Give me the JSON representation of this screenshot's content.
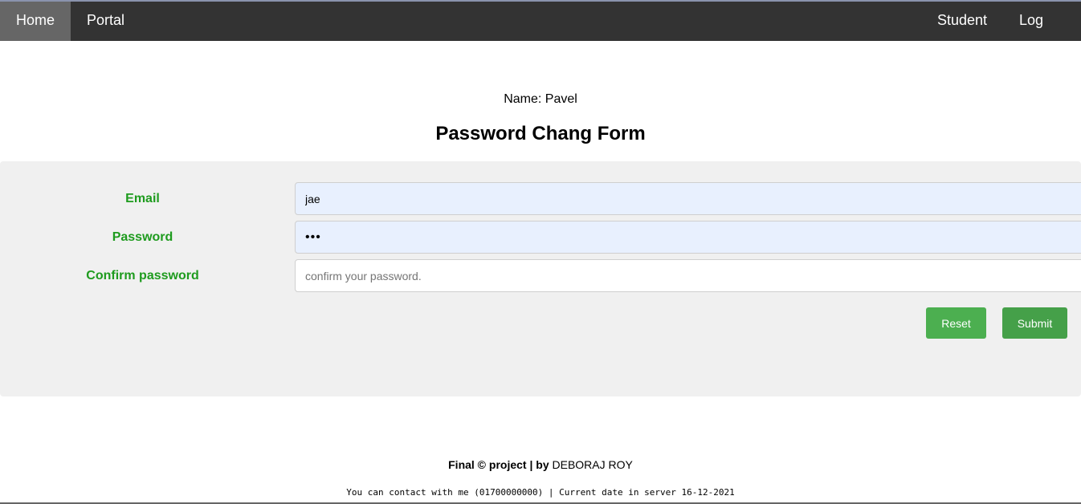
{
  "nav": {
    "home": "Home",
    "portal": "Portal",
    "student": "Student",
    "logout": "Log out"
  },
  "user": {
    "name_line": "Name: Pavel"
  },
  "form": {
    "title": "Password Chang Form",
    "email_label": "Email",
    "email_value": "jae",
    "password_label": "Password",
    "password_value": "•••",
    "confirm_label": "Confirm password",
    "confirm_value": "",
    "confirm_placeholder": "confirm your password.",
    "reset_label": "Reset",
    "submit_label": "Submit"
  },
  "footer": {
    "prefix": "Final © project | by ",
    "author": "DEBORAJ ROY",
    "contact": "You can contact with me (01700000000) | Current date in server 16-12-2021"
  },
  "colors": {
    "navbar": "#333333",
    "nav_active": "#666666",
    "label_green": "#1e9b1e",
    "button_green": "#4caf50",
    "panel": "#f0f0f0",
    "autofill": "#e8f0fe"
  }
}
